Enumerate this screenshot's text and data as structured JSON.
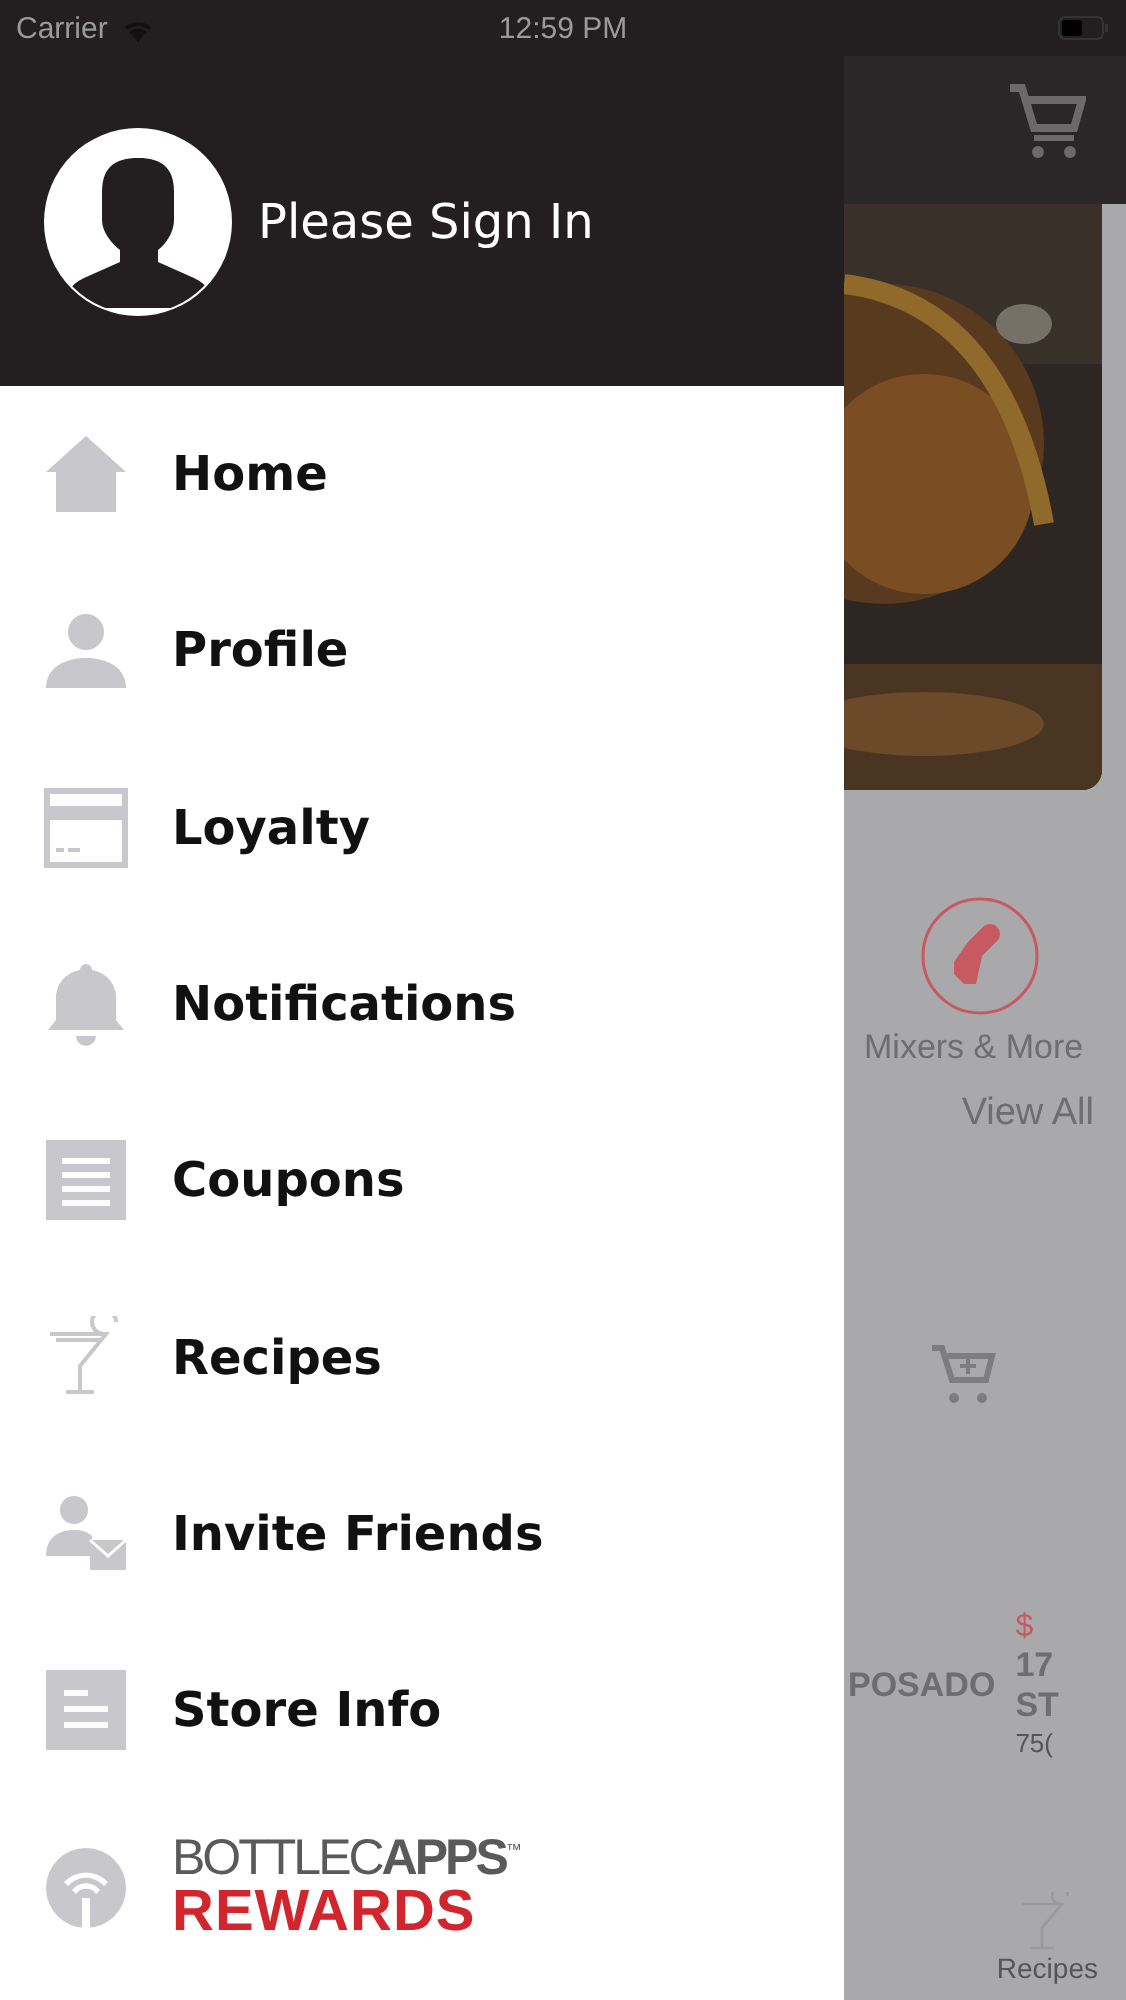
{
  "status_bar": {
    "carrier": "Carrier",
    "time": "12:59 PM"
  },
  "drawer": {
    "profile": {
      "label": "Please Sign In"
    },
    "menu": [
      {
        "label": "Home"
      },
      {
        "label": "Profile"
      },
      {
        "label": "Loyalty"
      },
      {
        "label": "Notifications"
      },
      {
        "label": "Coupons"
      },
      {
        "label": "Recipes"
      },
      {
        "label": "Invite Friends"
      },
      {
        "label": "Store Info"
      }
    ],
    "rewards": {
      "brand": "BOTTLEC**APPS**$^{™}$",
      "label": "REWARDS"
    }
  },
  "background": {
    "category": {
      "label": "Mixers & More"
    },
    "view_all": "View All",
    "product": {
      "name": "POSADO",
      "price": "$",
      "title_lines": [
        "17",
        "ST"
      ],
      "size": "75("
    },
    "tab_bar": [
      {
        "label": "Recipes"
      }
    ]
  }
}
